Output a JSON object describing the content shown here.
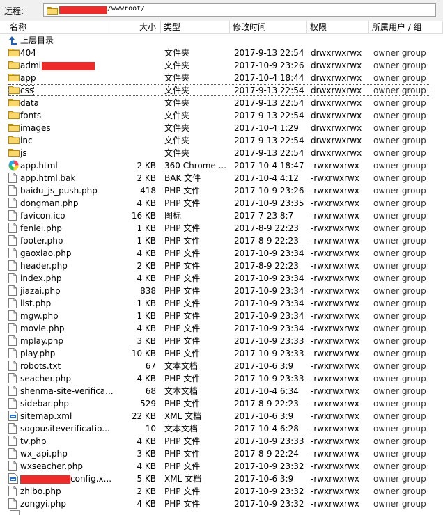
{
  "remote": {
    "label": "远程:",
    "path": "/wwwroot/"
  },
  "columns": {
    "name": "名称",
    "size": "大小",
    "type": "类型",
    "modified": "修改时间",
    "permissions": "权限",
    "owner": "所属用户 / 组"
  },
  "parent_dir": "上层目录",
  "rows": [
    {
      "name": "404",
      "size": "",
      "type": "文件夹",
      "modified": "2017-9-13 22:54",
      "perm": "drwxrwxrwx",
      "owner": "owner group",
      "icon": "folder-icon"
    },
    {
      "name": "admi",
      "size": "",
      "type": "文件夹",
      "modified": "2017-10-9 23:26",
      "perm": "drwxrwxrwx",
      "owner": "owner group",
      "icon": "folder-icon",
      "redacted_suffix": true
    },
    {
      "name": "app",
      "size": "",
      "type": "文件夹",
      "modified": "2017-10-4 18:44",
      "perm": "drwxrwxrwx",
      "owner": "owner group",
      "icon": "folder-icon"
    },
    {
      "name": "css",
      "size": "",
      "type": "文件夹",
      "modified": "2017-9-13 22:54",
      "perm": "drwxrwxrwx",
      "owner": "owner group",
      "icon": "folder-icon",
      "selected": true
    },
    {
      "name": "data",
      "size": "",
      "type": "文件夹",
      "modified": "2017-9-13 22:54",
      "perm": "drwxrwxrwx",
      "owner": "owner group",
      "icon": "folder-icon"
    },
    {
      "name": "fonts",
      "size": "",
      "type": "文件夹",
      "modified": "2017-9-13 22:54",
      "perm": "drwxrwxrwx",
      "owner": "owner group",
      "icon": "folder-icon"
    },
    {
      "name": "images",
      "size": "",
      "type": "文件夹",
      "modified": "2017-10-4 1:29",
      "perm": "drwxrwxrwx",
      "owner": "owner group",
      "icon": "folder-icon"
    },
    {
      "name": "inc",
      "size": "",
      "type": "文件夹",
      "modified": "2017-9-13 22:54",
      "perm": "drwxrwxrwx",
      "owner": "owner group",
      "icon": "folder-icon"
    },
    {
      "name": "js",
      "size": "",
      "type": "文件夹",
      "modified": "2017-9-13 22:54",
      "perm": "drwxrwxrwx",
      "owner": "owner group",
      "icon": "folder-icon"
    },
    {
      "name": "app.html",
      "size": "2 KB",
      "type": "360 Chrome ...",
      "modified": "2017-10-4 18:47",
      "perm": "-rwxrwxrwx",
      "owner": "owner group",
      "icon": "browser-icon"
    },
    {
      "name": "app.html.bak",
      "size": "2 KB",
      "type": "BAK 文件",
      "modified": "2017-10-4 4:12",
      "perm": "-rwxrwxrwx",
      "owner": "owner group",
      "icon": "file-icon"
    },
    {
      "name": "baidu_js_push.php",
      "size": "418",
      "type": "PHP 文件",
      "modified": "2017-10-9 23:26",
      "perm": "-rwxrwxrwx",
      "owner": "owner group",
      "icon": "file-icon"
    },
    {
      "name": "dongman.php",
      "size": "4 KB",
      "type": "PHP 文件",
      "modified": "2017-10-9 23:35",
      "perm": "-rwxrwxrwx",
      "owner": "owner group",
      "icon": "file-icon"
    },
    {
      "name": "favicon.ico",
      "size": "16 KB",
      "type": "图标",
      "modified": "2017-7-23 8:7",
      "perm": "-rwxrwxrwx",
      "owner": "owner group",
      "icon": "file-icon"
    },
    {
      "name": "fenlei.php",
      "size": "1 KB",
      "type": "PHP 文件",
      "modified": "2017-8-9 22:23",
      "perm": "-rwxrwxrwx",
      "owner": "owner group",
      "icon": "file-icon"
    },
    {
      "name": "footer.php",
      "size": "1 KB",
      "type": "PHP 文件",
      "modified": "2017-8-9 22:23",
      "perm": "-rwxrwxrwx",
      "owner": "owner group",
      "icon": "file-icon"
    },
    {
      "name": "gaoxiao.php",
      "size": "4 KB",
      "type": "PHP 文件",
      "modified": "2017-10-9 23:34",
      "perm": "-rwxrwxrwx",
      "owner": "owner group",
      "icon": "file-icon"
    },
    {
      "name": "header.php",
      "size": "2 KB",
      "type": "PHP 文件",
      "modified": "2017-8-9 22:23",
      "perm": "-rwxrwxrwx",
      "owner": "owner group",
      "icon": "file-icon"
    },
    {
      "name": "index.php",
      "size": "4 KB",
      "type": "PHP 文件",
      "modified": "2017-10-9 23:34",
      "perm": "-rwxrwxrwx",
      "owner": "owner group",
      "icon": "file-icon"
    },
    {
      "name": "jiazai.php",
      "size": "838",
      "type": "PHP 文件",
      "modified": "2017-10-9 23:34",
      "perm": "-rwxrwxrwx",
      "owner": "owner group",
      "icon": "file-icon"
    },
    {
      "name": "list.php",
      "size": "1 KB",
      "type": "PHP 文件",
      "modified": "2017-10-9 23:34",
      "perm": "-rwxrwxrwx",
      "owner": "owner group",
      "icon": "file-icon"
    },
    {
      "name": "mgw.php",
      "size": "1 KB",
      "type": "PHP 文件",
      "modified": "2017-10-9 23:34",
      "perm": "-rwxrwxrwx",
      "owner": "owner group",
      "icon": "file-icon"
    },
    {
      "name": "movie.php",
      "size": "4 KB",
      "type": "PHP 文件",
      "modified": "2017-10-9 23:34",
      "perm": "-rwxrwxrwx",
      "owner": "owner group",
      "icon": "file-icon"
    },
    {
      "name": "mplay.php",
      "size": "3 KB",
      "type": "PHP 文件",
      "modified": "2017-10-9 23:33",
      "perm": "-rwxrwxrwx",
      "owner": "owner group",
      "icon": "file-icon"
    },
    {
      "name": "play.php",
      "size": "10 KB",
      "type": "PHP 文件",
      "modified": "2017-10-9 23:33",
      "perm": "-rwxrwxrwx",
      "owner": "owner group",
      "icon": "file-icon"
    },
    {
      "name": "robots.txt",
      "size": "67",
      "type": "文本文档",
      "modified": "2017-10-6 3:9",
      "perm": "-rwxrwxrwx",
      "owner": "owner group",
      "icon": "file-icon"
    },
    {
      "name": "seacher.php",
      "size": "4 KB",
      "type": "PHP 文件",
      "modified": "2017-10-9 23:33",
      "perm": "-rwxrwxrwx",
      "owner": "owner group",
      "icon": "file-icon"
    },
    {
      "name": "shenma-site-verifica...",
      "size": "68",
      "type": "文本文档",
      "modified": "2017-10-4 6:34",
      "perm": "-rwxrwxrwx",
      "owner": "owner group",
      "icon": "file-icon"
    },
    {
      "name": "sidebar.php",
      "size": "529",
      "type": "PHP 文件",
      "modified": "2017-8-9 22:23",
      "perm": "-rwxrwxrwx",
      "owner": "owner group",
      "icon": "file-icon"
    },
    {
      "name": "sitemap.xml",
      "size": "22 KB",
      "type": "XML 文档",
      "modified": "2017-10-6 3:9",
      "perm": "-rwxrwxrwx",
      "owner": "owner group",
      "icon": "xml-icon"
    },
    {
      "name": "sogousiteverificatio...",
      "size": "10",
      "type": "文本文档",
      "modified": "2017-10-4 6:28",
      "perm": "-rwxrwxrwx",
      "owner": "owner group",
      "icon": "file-icon"
    },
    {
      "name": "tv.php",
      "size": "4 KB",
      "type": "PHP 文件",
      "modified": "2017-10-9 23:33",
      "perm": "-rwxrwxrwx",
      "owner": "owner group",
      "icon": "file-icon"
    },
    {
      "name": "wx_api.php",
      "size": "3 KB",
      "type": "PHP 文件",
      "modified": "2017-8-9 22:24",
      "perm": "-rwxrwxrwx",
      "owner": "owner group",
      "icon": "file-icon"
    },
    {
      "name": "wxseacher.php",
      "size": "4 KB",
      "type": "PHP 文件",
      "modified": "2017-10-9 23:32",
      "perm": "-rwxrwxrwx",
      "owner": "owner group",
      "icon": "file-icon"
    },
    {
      "name": "config.x...",
      "size": "5 KB",
      "type": "XML 文档",
      "modified": "2017-10-6 3:9",
      "perm": "-rwxrwxrwx",
      "owner": "owner group",
      "icon": "xml-icon",
      "redacted_prefix": true
    },
    {
      "name": "zhibo.php",
      "size": "2 KB",
      "type": "PHP 文件",
      "modified": "2017-10-9 23:32",
      "perm": "-rwxrwxrwx",
      "owner": "owner group",
      "icon": "file-icon"
    },
    {
      "name": "zongyi.php",
      "size": "4 KB",
      "type": "PHP 文件",
      "modified": "2017-10-9 23:32",
      "perm": "-rwxrwxrwx",
      "owner": "owner group",
      "icon": "file-icon"
    }
  ],
  "colors": {
    "redaction": "#ee2b2b",
    "folder": "#f4c542",
    "text_dim": "#333333"
  }
}
